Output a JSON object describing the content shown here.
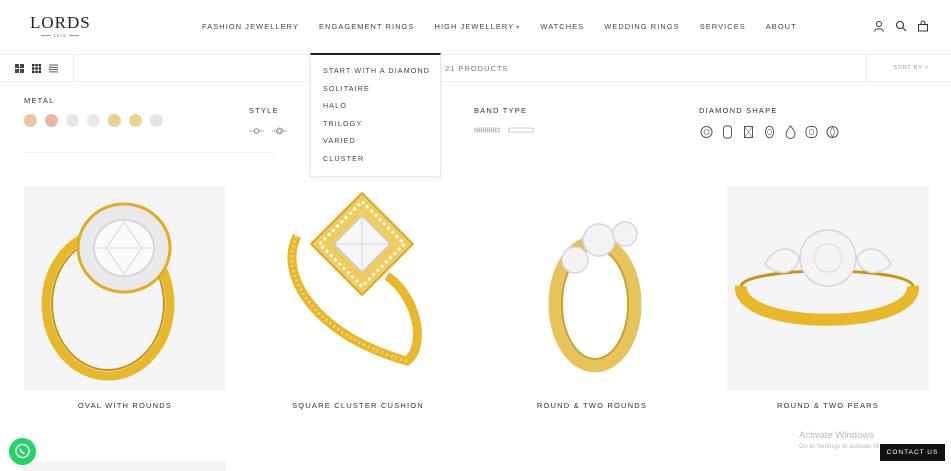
{
  "header": {
    "logo_text": "LORDS",
    "logo_sub": "1975",
    "nav": [
      {
        "label": "FASHION JEWELLERY",
        "chevron": false
      },
      {
        "label": "ENGAGEMENT RINGS",
        "chevron": false
      },
      {
        "label": "HIGH JEWELLERY",
        "chevron": true
      },
      {
        "label": "WATCHES",
        "chevron": false
      },
      {
        "label": "WEDDING RINGS",
        "chevron": false
      },
      {
        "label": "SERVICES",
        "chevron": false
      },
      {
        "label": "ABOUT",
        "chevron": false
      }
    ],
    "icons": [
      "account-icon",
      "search-icon",
      "bag-icon"
    ]
  },
  "dropdown": {
    "items": [
      "START WITH A DIAMOND",
      "SOLITAIRE",
      "HALO",
      "TRILOGY",
      "VARIED",
      "CLUSTER"
    ]
  },
  "toolbar": {
    "product_count": "21 PRODUCTS",
    "sort_by": "SORT BY",
    "sort_chevron": "˅",
    "view_icons": [
      "grid-2-icon",
      "grid-3-icon",
      "list-icon"
    ]
  },
  "filters": {
    "metal": {
      "title": "METAL",
      "swatches": [
        "#efc3a6",
        "#ebb59f",
        "#e6e6e6",
        "#e8e8e8",
        "#ecd08d",
        "#ecd492",
        "#e4e4e4"
      ]
    },
    "style": {
      "title": "STYLE",
      "icons": [
        "solitaire-style-icon",
        "halo-style-icon"
      ]
    },
    "band_type": {
      "title": "BAND TYPE",
      "icons": [
        "pave-band-icon",
        "plain-band-icon"
      ]
    },
    "diamond_shape": {
      "title": "DIAMOND SHAPE",
      "icons": [
        "round-shape-icon",
        "emerald-shape-icon",
        "princess-shape-icon",
        "oval-shape-icon",
        "pear-shape-icon",
        "cushion-shape-icon",
        "brilliant-shape-icon"
      ]
    }
  },
  "products": [
    {
      "name": "OVAL WITH ROUNDS"
    },
    {
      "name": "SQUARE CLUSTER CUSHION"
    },
    {
      "name": "ROUND & TWO ROUNDS"
    },
    {
      "name": "ROUND & TWO PEARS"
    }
  ],
  "overlay": {
    "activate_title": "Activate Windows",
    "activate_sub": "Go to Settings to activate Windows.",
    "contact_label": "CONTACT US"
  },
  "colors": {
    "gold": "#e8b82a",
    "gold_dark": "#b98a10",
    "whatsapp": "#25d366"
  }
}
